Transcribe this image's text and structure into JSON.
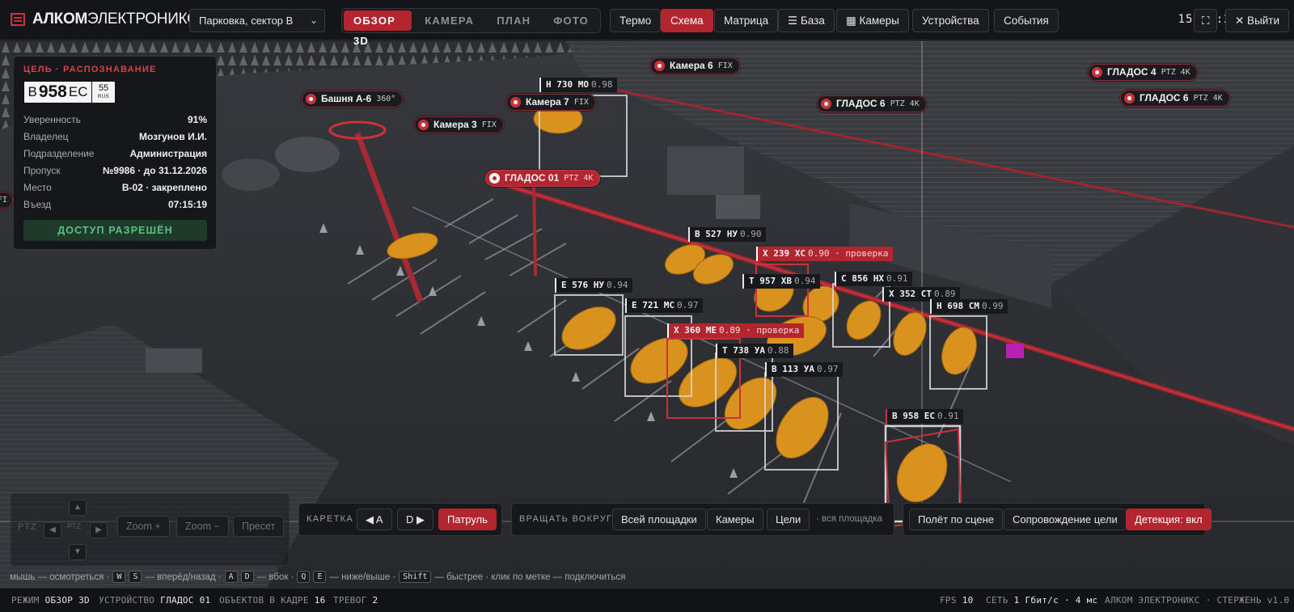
{
  "app": {
    "brand_bold": "АЛКОМ",
    "brand_light": "ЭЛЕКТРОНИКС"
  },
  "header": {
    "site_select": "Парковка, сектор B",
    "view_tabs": [
      {
        "label": "ОБЗОР 3D",
        "active": true
      },
      {
        "label": "КАМЕРА",
        "active": false
      },
      {
        "label": "ПЛАН",
        "active": false
      },
      {
        "label": "ФОТО",
        "active": false
      }
    ],
    "buttons": {
      "thermo": "Термо",
      "scheme": "Схема",
      "matrix": "Матрица",
      "base": "☰ База",
      "cameras": "▦ Камеры",
      "devices": "Устройства",
      "events": "События",
      "fullscreen": "⛶",
      "exit": "✕ Выйти"
    },
    "clock": "15:20:28"
  },
  "target_panel": {
    "heading": "ЦЕЛЬ · РАСПОЗНАВАНИЕ",
    "plate": {
      "prefix": "В",
      "digits": "958",
      "suffix": "ЕС",
      "region": "55",
      "country": "RUS"
    },
    "rows": [
      {
        "key": "Уверенность",
        "value": "91%"
      },
      {
        "key": "Владелец",
        "value": "Мозгунов И.И."
      },
      {
        "key": "Подразделение",
        "value": "Администрация"
      },
      {
        "key": "Пропуск",
        "value": "№9986 · до 31.12.2026"
      },
      {
        "key": "Место",
        "value": "B-02 · закреплено"
      },
      {
        "key": "Въезд",
        "value": "07:15:19"
      }
    ],
    "access": "ДОСТУП РАЗРЕШЁН"
  },
  "cameras": [
    {
      "name": "Башня А-6",
      "type": "360°"
    },
    {
      "name": "Камера 3",
      "type": "FIX"
    },
    {
      "name": "Камера 7",
      "type": "FIX"
    },
    {
      "name": "Камера 6",
      "type": "FIX"
    },
    {
      "name": "ГЛАДОС 01",
      "type": "PTZ 4K"
    },
    {
      "name": "ГЛАДОС 6",
      "type": "PTZ 4K"
    },
    {
      "name": "ГЛАДОС 4",
      "type": "PTZ 4K"
    },
    {
      "name": "ГЛАДОС 6",
      "type": "PTZ 4K"
    },
    {
      "name": "",
      "type": "FI"
    }
  ],
  "plates": [
    {
      "text": "Н 730 МО",
      "conf": "0.98",
      "status": ""
    },
    {
      "text": "В 527 НУ",
      "conf": "0.90",
      "status": ""
    },
    {
      "text": "Х 239 ХС",
      "conf": "0.90 · проверка",
      "status": "alarm"
    },
    {
      "text": "Т 957 ХВ",
      "conf": "0.94",
      "status": ""
    },
    {
      "text": "С 856 НХ",
      "conf": "0.91",
      "status": ""
    },
    {
      "text": "Е 576 НУ",
      "conf": "0.94",
      "status": ""
    },
    {
      "text": "Х 352 СТ",
      "conf": "0.89",
      "status": ""
    },
    {
      "text": "Е 721 МС",
      "conf": "0.97",
      "status": ""
    },
    {
      "text": "Н 698 СМ",
      "conf": "0.99",
      "status": ""
    },
    {
      "text": "Х 360 МЕ",
      "conf": "0.89 · проверка",
      "status": "alarm"
    },
    {
      "text": "Т 738 УА",
      "conf": "0.88",
      "status": ""
    },
    {
      "text": "В 113 УА",
      "conf": "0.97",
      "status": ""
    },
    {
      "text": "В 958 ЕС",
      "conf": "0.91",
      "status": "target"
    }
  ],
  "ptz": {
    "label": "PTZ",
    "center": "PTZ",
    "up": "▲",
    "down": "▼",
    "left": "◀",
    "right": "▶",
    "zoom_in": "Zoom +",
    "zoom_out": "Zoom −",
    "preset": "Пресет"
  },
  "carriage": {
    "label": "КАРЕТКА",
    "a": "◀ A",
    "d": "D ▶",
    "patrol": "Патруль"
  },
  "orbit": {
    "label": "ВРАЩАТЬ ВОКРУГ",
    "all": "Всей площадки",
    "cams": "Камеры",
    "targets": "Цели",
    "hint": "· вся площадка"
  },
  "modes": {
    "flight": "Полёт по сцене",
    "follow": "Сопровождение цели",
    "detect": "Детекция: вкл"
  },
  "hints": {
    "mouse": "мышь — осмотреться ·",
    "w": "W",
    "s": "S",
    "ws": "— вперёд/назад ·",
    "a": "A",
    "d": "D",
    "ad": "— вбок ·",
    "q": "Q",
    "e": "E",
    "qe": "— ниже/выше ·",
    "shift": "Shift",
    "rest": "— быстрее · клик по метке — подключиться"
  },
  "status": {
    "mode_label": "РЕЖИМ",
    "mode_value": "ОБЗОР 3D",
    "device_label": "УСТРОЙСТВО",
    "device_value": "ГЛАДОС 01",
    "objects_label": "ОБЪЕКТОВ В КАДРЕ",
    "objects_value": "16",
    "alarms_label": "ТРЕВОГ",
    "alarms_value": "2",
    "fps_label": "FPS",
    "fps_value": "10",
    "net_label": "СЕТЬ",
    "net_value": "1 Гбит/с · 4 мс",
    "version": "АЛКОМ ЭЛЕКТРОНИКС · СТЕРЖЕНЬ v1.0"
  },
  "colors": {
    "accent": "#b3262f",
    "vehicle": "#d9921e",
    "ok": "#57c282"
  }
}
